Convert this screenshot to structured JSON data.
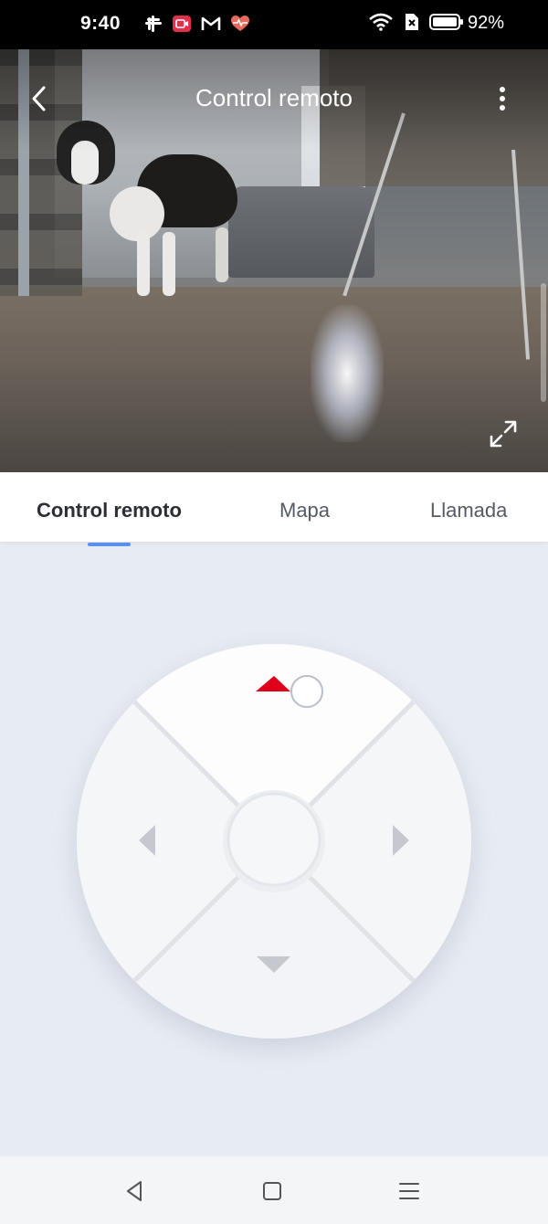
{
  "status_bar": {
    "time": "9:40",
    "battery_percent": "92%",
    "left_icons": [
      "slack-icon",
      "screen-record-icon",
      "gmail-icon",
      "health-heart-icon"
    ],
    "right_icons": [
      "wifi-icon",
      "no-sim-icon",
      "battery-icon"
    ]
  },
  "header": {
    "title": "Control remoto",
    "back_icon": "chevron-left-icon",
    "more_icon": "more-vertical-icon",
    "fullscreen_icon": "expand-icon"
  },
  "tabs": [
    {
      "label": "Control remoto",
      "active": true
    },
    {
      "label": "Mapa",
      "active": false
    },
    {
      "label": "Llamada",
      "active": false
    }
  ],
  "control_pad": {
    "buttons": [
      "up",
      "left",
      "right",
      "down",
      "center"
    ],
    "active_direction": "up",
    "indicator_color": "#e0001b",
    "accent_color": "#5a8ff0"
  },
  "nav_bar": {
    "buttons": [
      "back-triangle-icon",
      "home-square-icon",
      "menu-lines-icon"
    ]
  }
}
